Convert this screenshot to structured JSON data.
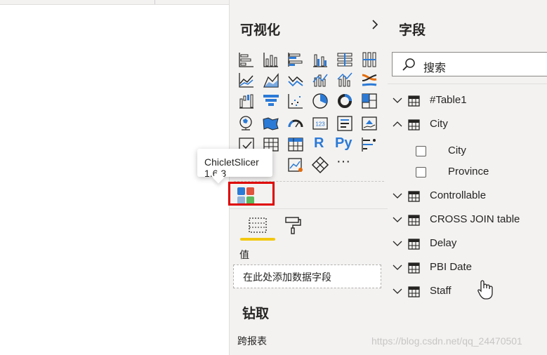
{
  "viz_pane": {
    "title": "可视化",
    "tooltip": "ChicletSlicer 1.6.3",
    "values_label": "值",
    "drop_placeholder": "在此处添加数据字段",
    "drillthrough_title": "钻取",
    "cross_report_label": "跨报表",
    "r_visual_label": "R",
    "python_visual_label": "Py",
    "more_label": "···"
  },
  "fields_pane": {
    "title": "字段",
    "search_placeholder": "搜索",
    "tables": [
      {
        "name": "#Table1",
        "expanded": false
      },
      {
        "name": "City",
        "expanded": true,
        "fields": [
          "City",
          "Province"
        ]
      },
      {
        "name": "Controllable",
        "expanded": false
      },
      {
        "name": "CROSS JOIN table",
        "expanded": false
      },
      {
        "name": "Delay",
        "expanded": false
      },
      {
        "name": "PBI Date",
        "expanded": false
      },
      {
        "name": "Staff",
        "expanded": false
      }
    ]
  },
  "watermark": "https://blog.csdn.net/qq_24470501",
  "colors": {
    "accent": "#f2c811",
    "highlight": "#e00000",
    "icon": "#605e5c",
    "blue": "#2b7ad6"
  }
}
